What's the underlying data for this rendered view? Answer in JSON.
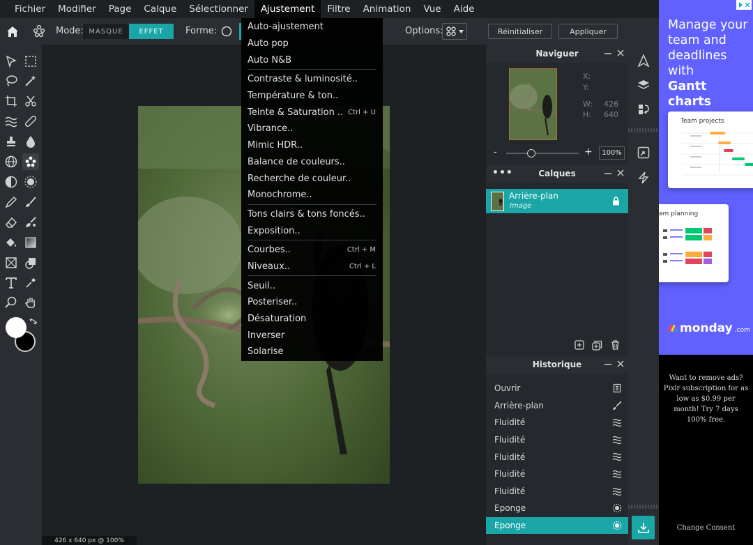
{
  "colors": {
    "accent": "#1aa6a6",
    "bg": "#1e2124",
    "panel": "#2a2d31",
    "ad_bg": "#6161ff"
  },
  "menubar": {
    "items": [
      "Fichier",
      "Modifier",
      "Page",
      "Calque",
      "Sélectionner",
      "Ajustement",
      "Filtre",
      "Animation",
      "Vue",
      "Aide"
    ],
    "active": "Ajustement"
  },
  "toolbar": {
    "mode_label": "Mode:",
    "mode_off": "MASQUE",
    "mode_on": "EFFET",
    "shape_label": "Forme:",
    "options_label": "Options:",
    "reset_label": "Réinitialiser",
    "apply_label": "Appliquer"
  },
  "dropdown": {
    "groups": [
      [
        {
          "label": "Auto-ajustement"
        },
        {
          "label": "Auto pop"
        },
        {
          "label": "Auto N&B"
        }
      ],
      [
        {
          "label": "Contraste & luminosité.."
        },
        {
          "label": "Température & ton.."
        },
        {
          "label": "Teinte & Saturation ..",
          "shortcut": "Ctrl + U"
        },
        {
          "label": "Vibrance.."
        },
        {
          "label": "Mimic HDR.."
        },
        {
          "label": "Balance de couleurs.."
        },
        {
          "label": "Recherche de couleur.."
        },
        {
          "label": "Monochrome.."
        }
      ],
      [
        {
          "label": "Tons clairs & tons foncés.."
        },
        {
          "label": "Exposition.."
        }
      ],
      [
        {
          "label": "Courbes..",
          "shortcut": "Ctrl + M"
        },
        {
          "label": "Niveaux..",
          "shortcut": "Ctrl + L"
        }
      ],
      [
        {
          "label": "Seuil.."
        },
        {
          "label": "Posteriser.."
        },
        {
          "label": "Désaturation"
        },
        {
          "label": "Inverser"
        },
        {
          "label": "Solarise"
        }
      ]
    ]
  },
  "navigator": {
    "title": "Naviguer",
    "x_label": "X:",
    "y_label": "Y:",
    "w_label": "W:",
    "w_value": "426",
    "h_label": "H:",
    "h_value": "640",
    "zoom_minus": "-",
    "zoom_plus": "+",
    "zoom_value": "100%",
    "zoom_fraction": 0.35
  },
  "layers": {
    "title": "Calques",
    "items": [
      {
        "name": "Arrière-plan",
        "type": "Image"
      }
    ]
  },
  "history": {
    "title": "Historique",
    "items": [
      {
        "label": "Ouvrir",
        "icon": "file-icon"
      },
      {
        "label": "Arrière-plan",
        "icon": "brush-icon"
      },
      {
        "label": "Fluidité",
        "icon": "liquify-icon"
      },
      {
        "label": "Fluidité",
        "icon": "liquify-icon"
      },
      {
        "label": "Fluidité",
        "icon": "liquify-icon"
      },
      {
        "label": "Fluidité",
        "icon": "liquify-icon"
      },
      {
        "label": "Fluidité",
        "icon": "liquify-icon"
      },
      {
        "label": "Eponge",
        "icon": "sponge-icon"
      },
      {
        "label": "Eponge",
        "icon": "sponge-icon"
      }
    ],
    "selected_index": 8
  },
  "status": {
    "text": "426 x 640 px @ 100%"
  },
  "ad": {
    "headline": "Manage your team and deadlines with",
    "headline_bold": "Gantt charts",
    "card1_title": "Team projects",
    "card2_title": "am planning",
    "brand": "monday",
    "brand_suffix": ".com",
    "remove_text": "Want to remove ads? Pixlr subscription for as low as $0.99 per month! Try 7 days 100% free.",
    "consent": "Change Consent"
  }
}
